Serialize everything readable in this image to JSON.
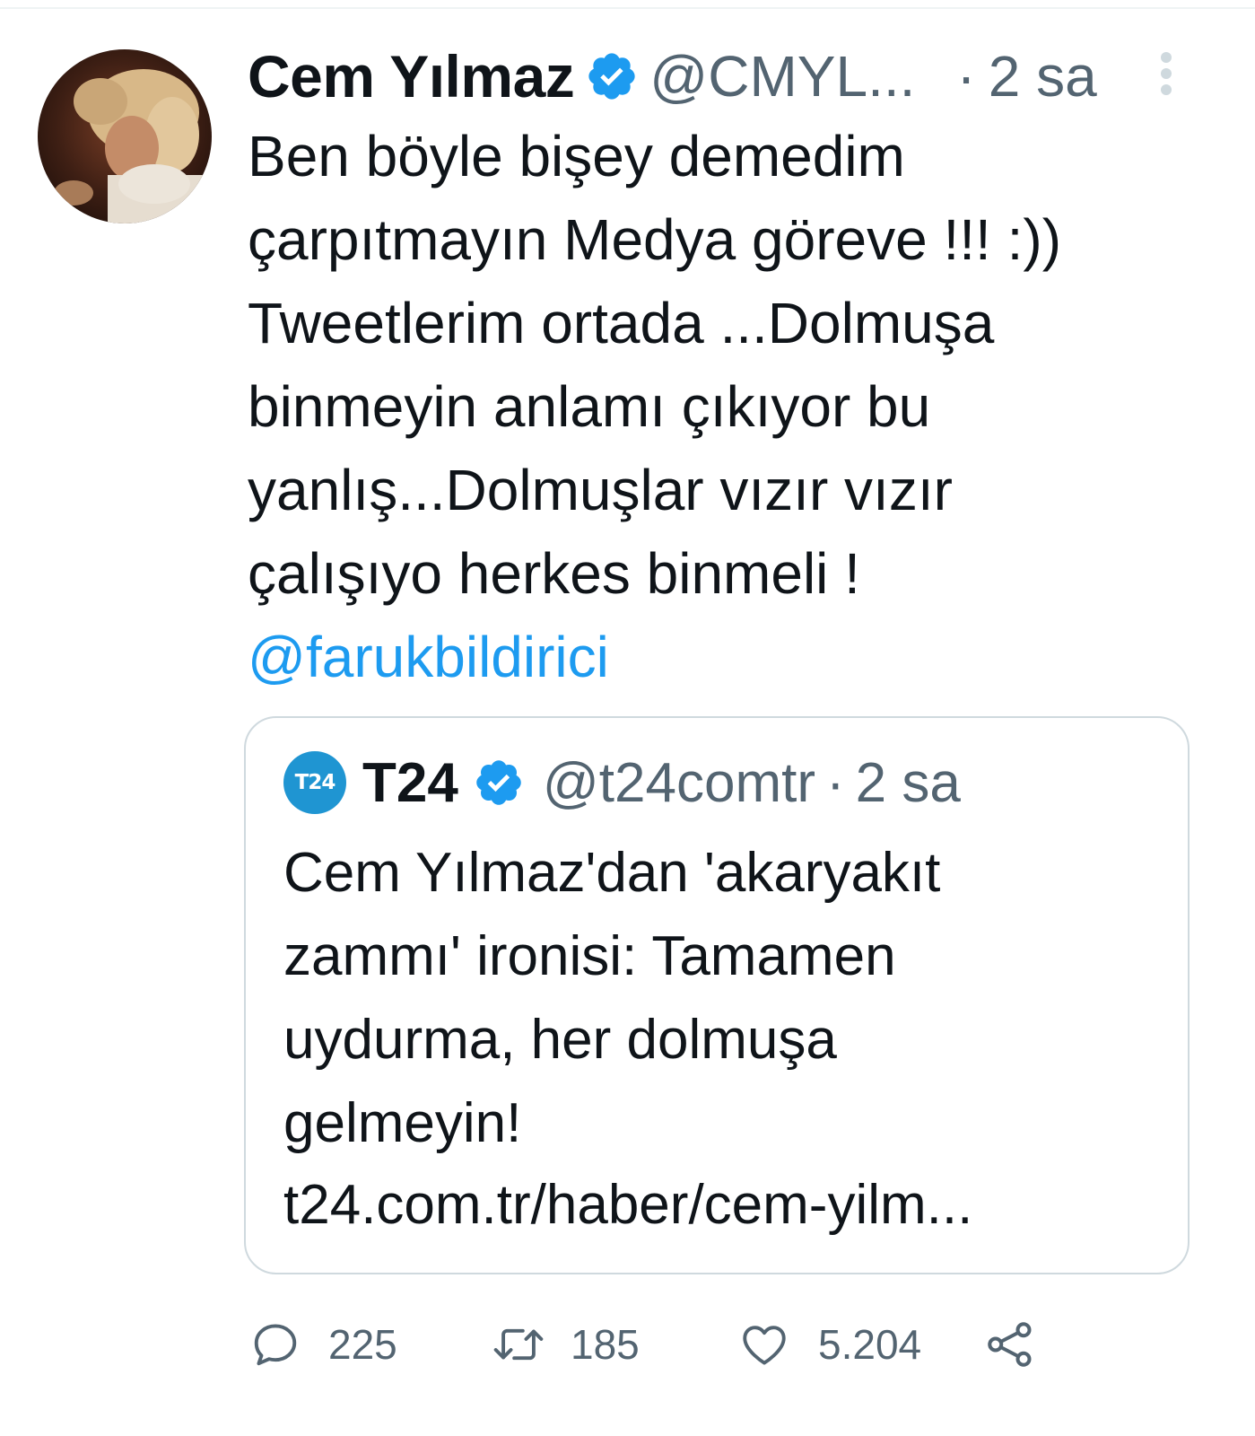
{
  "tweet": {
    "author": {
      "name": "Cem Yılmaz",
      "handle": "@CMYL...",
      "verified": true
    },
    "separator": "·",
    "time": "2 sa",
    "text": "Ben böyle bişey demedim\nçarpıtmayın Medya göreve !!! :))\nTweetlerim ortada ...Dolmuşa\nbinmeyin anlamı çıkıyor bu\nyanlış...Dolmuşlar vızır vızır\nçalışıyo herkes binmeli !",
    "mention": "@farukbildirici"
  },
  "quote": {
    "avatar_text": "T24",
    "name": "T24",
    "handle": "@t24comtr",
    "separator": "·",
    "time": "2 sa",
    "text": "Cem Yılmaz'dan 'akaryakıt\nzammı' ironisi: Tamamen\nuydurma, her dolmuşa\ngelmeyin!",
    "link": "t24.com.tr/haber/cem-yilm..."
  },
  "actions": {
    "replies": "225",
    "retweets": "185",
    "likes": "5.204"
  },
  "colors": {
    "accent": "#1d9bf0",
    "secondary_text": "#536471",
    "border": "#cfd9de",
    "t24_brand": "#1f95d2"
  },
  "icons": [
    "verified-badge-icon",
    "more-icon",
    "reply-icon",
    "retweet-icon",
    "like-icon",
    "share-icon"
  ]
}
